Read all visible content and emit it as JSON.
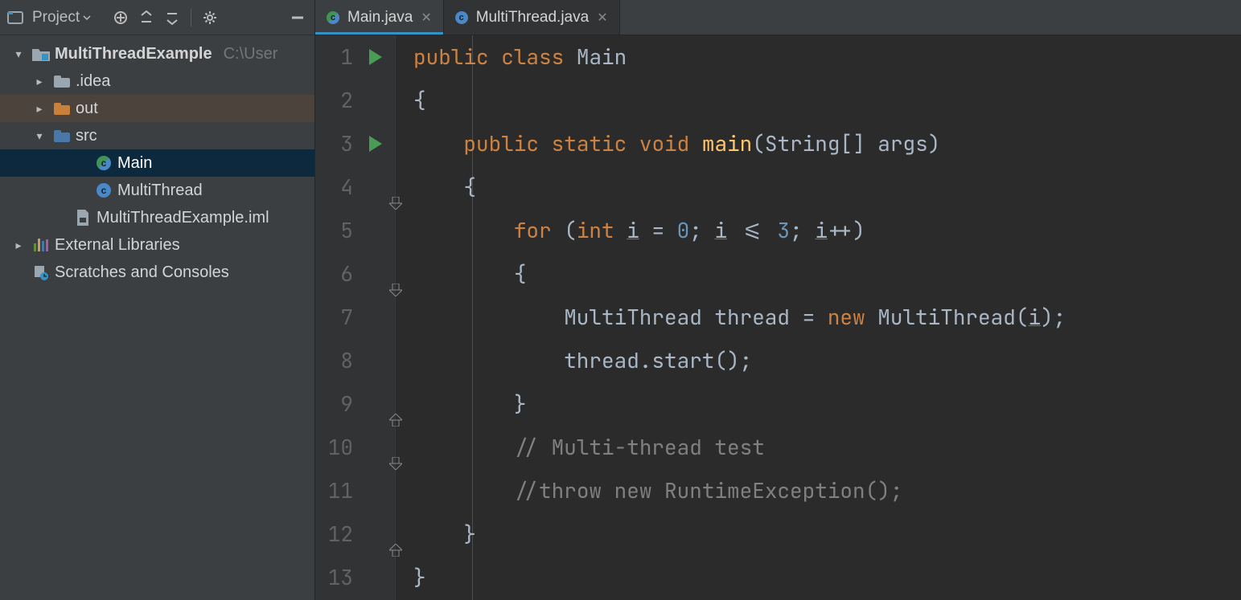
{
  "sidebar": {
    "toolbar": {
      "project_label": "Project"
    },
    "tree": {
      "root": {
        "name": "MultiThreadExample",
        "suffix": "C:\\User"
      },
      "idea_folder": ".idea",
      "out_folder": "out",
      "src_folder": "src",
      "main_file": "Main",
      "multithread_file": "MultiThread",
      "iml_file": "MultiThreadExample.iml",
      "external_libs": "External Libraries",
      "scratches": "Scratches and Consoles"
    }
  },
  "tabs": [
    {
      "label": "Main.java",
      "active": true,
      "icon": "run"
    },
    {
      "label": "MultiThread.java",
      "active": false,
      "icon": "norm"
    }
  ],
  "editor": {
    "line_numbers": [
      "1",
      "2",
      "3",
      "4",
      "5",
      "6",
      "7",
      "8",
      "9",
      "10",
      "11",
      "12",
      "13"
    ],
    "run_lines": [
      1,
      3
    ],
    "fold_lines": [
      4,
      6,
      9,
      10,
      12
    ],
    "code": {
      "l1_kw1": "public",
      "l1_kw2": "class",
      "l1_name": "Main",
      "l2": "{",
      "l3_kw1": "public",
      "l3_kw2": "static",
      "l3_kw3": "void",
      "l3_m": "main",
      "l3_rest": "(String[] args)",
      "l4": "{",
      "l5_kw1": "for",
      "l5_p1": " (",
      "l5_kw2": "int",
      "l5_sp": " ",
      "l5_v1": "i",
      "l5_eq": " = ",
      "l5_n1": "0",
      "l5_mid": "; ",
      "l5_v2": "i",
      "l5_op": " <= ",
      "l5_n2": "3",
      "l5_mid2": "; ",
      "l5_v3": "i",
      "l5_pp": "++)",
      "l6": "{",
      "l7_a": "MultiThread thread = ",
      "l7_kw": "new",
      "l7_b": " MultiThread(",
      "l7_v": "i",
      "l7_c": ");",
      "l8": "thread.start();",
      "l9": "}",
      "l10": "// Multi-thread test",
      "l11": "//throw new RuntimeException();",
      "l12": "}",
      "l13": "}"
    }
  }
}
